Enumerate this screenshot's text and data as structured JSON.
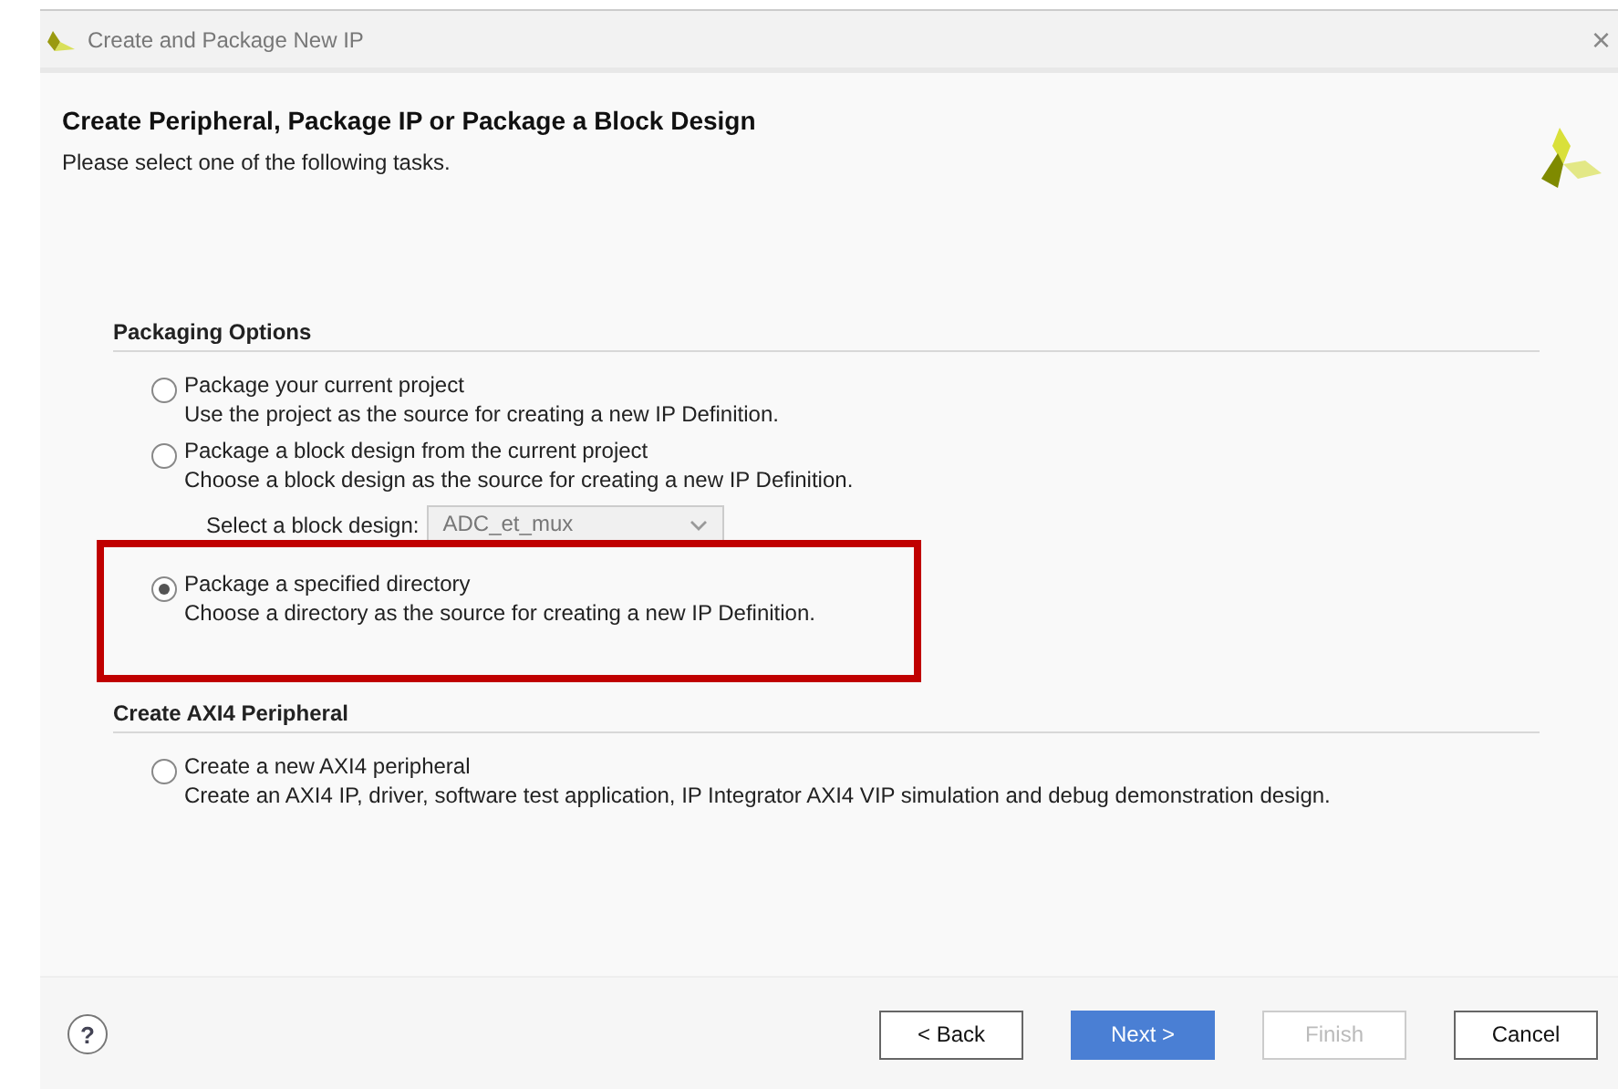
{
  "window": {
    "title": "Create and Package New IP",
    "close": "×"
  },
  "help": "?",
  "header": {
    "title": "Create Peripheral, Package IP or Package a Block Design",
    "subtitle": "Please select one of the following tasks."
  },
  "sections": [
    {
      "title": "Packaging Options",
      "options": [
        {
          "label": "Package your current project",
          "description": "Use the project as the source for creating a new IP Definition.",
          "selected": false,
          "highlighted": false
        },
        {
          "label": "Package a block design from the current project",
          "description": "Choose a block design as the source for creating a new IP Definition.",
          "selected": false,
          "highlighted": false,
          "dropdown": {
            "label": "Select a block design:",
            "value": "ADC_et_mux",
            "disabled": true
          }
        },
        {
          "label": "Package a specified directory",
          "description": "Choose a directory as the source for creating a new IP Definition.",
          "selected": true,
          "highlighted": true
        }
      ]
    },
    {
      "title": "Create AXI4 Peripheral",
      "options": [
        {
          "label": "Create a new AXI4 peripheral",
          "description": "Create an AXI4 IP, driver, software test application, IP Integrator AXI4 VIP simulation and debug demonstration design.",
          "selected": false,
          "highlighted": false
        }
      ]
    }
  ],
  "buttons": [
    {
      "label": "< Back",
      "kind": "normal",
      "disabled": false
    },
    {
      "label": "Next >",
      "kind": "primary",
      "disabled": false
    },
    {
      "label": "Finish",
      "kind": "normal",
      "disabled": true
    },
    {
      "label": "Cancel",
      "kind": "normal",
      "disabled": false
    }
  ]
}
